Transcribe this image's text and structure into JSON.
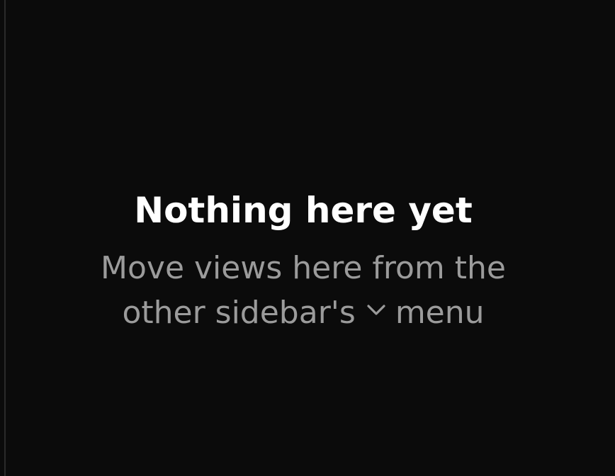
{
  "empty_state": {
    "title": "Nothing here yet",
    "line1": "Move views here from the",
    "line2_before_icon": "other sidebar's",
    "line2_after_icon": "menu",
    "inline_icon": "chevron-down-icon"
  },
  "colors": {
    "background": "#0b0b0b",
    "title": "#ffffff",
    "description": "#9b9b9b",
    "border": "#2a2a2a"
  }
}
